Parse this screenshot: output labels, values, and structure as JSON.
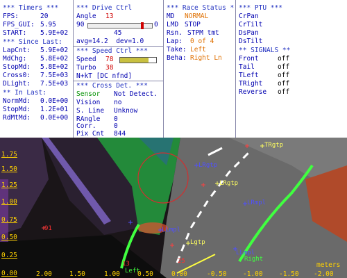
{
  "timers": {
    "title": "*** Timers ***",
    "rows": [
      {
        "label": "FPS:",
        "value": "20"
      },
      {
        "label": "FPS_GUI:",
        "value": "5.95"
      },
      {
        "label": "START:",
        "value": "5.9E+02"
      }
    ],
    "since_title": "*** Since Last:",
    "since_rows": [
      {
        "label": "LapCnt:",
        "value": "5.9E+02"
      },
      {
        "label": "MdChg:",
        "value": "5.8E+02"
      },
      {
        "label": "StopMd:",
        "value": "5.8E+02"
      },
      {
        "label": "Cross0:",
        "value": "7.5E+03"
      },
      {
        "label": "DLight:",
        "value": "7.5E+03"
      }
    ],
    "inlast_title": "** In Last:",
    "inlast_rows": [
      {
        "label": "NormMd:",
        "value": "0.0E+00"
      },
      {
        "label": "StopMd:",
        "value": "1.2E+01"
      },
      {
        "label": "RdMtMd:",
        "value": "0.0E+00"
      }
    ]
  },
  "drive": {
    "title": "*** Drive Ctrl",
    "angle_label": "Angle",
    "angle_value": "13",
    "slider_min": "90",
    "slider_max": "0",
    "slider_mid": "45",
    "slider_fraction": 0.86,
    "avg_text": "avg=14.2  dev=1.0",
    "speed_title": "*** Speed Ctrl ***",
    "speed_label": "Speed",
    "speed_value": "78",
    "speed_fraction": 0.78,
    "turbo_label": "Turbo",
    "turbo_value": "38",
    "nkt_text": "N+kT [DC nfnd]",
    "cross_title": "*** Cross Det. ***",
    "sensor_label": "Sensor",
    "sensor_value": "Not Detect.",
    "vision_label": "Vision",
    "vision_value": "no",
    "sline_label": "S. Line",
    "sline_value": "Unknow",
    "rangle_label": "RAngle",
    "rangle_value": "0",
    "corr_label": "Corr.",
    "corr_value": "0",
    "pix_label": "Pix Cnt",
    "pix_value": "844"
  },
  "race": {
    "title": "*** Race Status *",
    "rows": [
      {
        "label": "MD",
        "value": "NORMAL",
        "color": "#e07000"
      },
      {
        "label": "LMD",
        "value": "STOP",
        "color": "#0000b0"
      },
      {
        "label": "Rsn.",
        "value": "STPM tmt",
        "color": "#0000b0"
      },
      {
        "label": "Lap:",
        "value": "0 of 4",
        "color": "#e07000"
      },
      {
        "label": "Take:",
        "value": "Left",
        "color": "#e07000"
      },
      {
        "label": "Beha:",
        "value": "Right Ln",
        "color": "#e07000"
      }
    ]
  },
  "ptu": {
    "title": "*** PTU ***",
    "items": [
      "CrPan",
      "CrTilt",
      "DsPan",
      "DsTilt"
    ],
    "signals_title": "** SIGNALS **",
    "signals": [
      {
        "label": "Front",
        "value": "off"
      },
      {
        "label": "Tail",
        "value": "off"
      },
      {
        "label": "TLeft",
        "value": "off"
      },
      {
        "label": "TRight",
        "value": "off"
      },
      {
        "label": "Reverse",
        "value": "off"
      }
    ]
  },
  "camera": {
    "y_ticks": [
      "1.75",
      "1.50",
      "1.25",
      "1.00",
      "0.75",
      "0.50",
      "0.25",
      "0.00"
    ],
    "x_ticks": [
      "2.00",
      "1.50",
      "1.00",
      "0.50",
      "0.00",
      "-0.50",
      "-1.00",
      "-1.50",
      "-2.00"
    ],
    "units": "meters",
    "markers": [
      {
        "text": "TRgtp",
        "color": "#ffff60"
      },
      {
        "text": "LRgtp",
        "color": "#5050ff"
      },
      {
        "text": "LRgtp",
        "color": "#ffff60"
      },
      {
        "text": "LRmpl",
        "color": "#5050ff"
      },
      {
        "text": "LLmpl",
        "color": "#5050ff"
      },
      {
        "text": "Lgtp",
        "color": "#ffff60"
      },
      {
        "text": "LLmpl",
        "color": "#5050ff"
      },
      {
        "text": "Right",
        "color": "#40ff40"
      },
      {
        "text": "Left",
        "color": "#40ff40"
      },
      {
        "text": "91",
        "color": "#ff3030"
      },
      {
        "text": "13",
        "color": "#ff3030"
      },
      {
        "text": "25",
        "color": "#ff3030"
      }
    ]
  }
}
